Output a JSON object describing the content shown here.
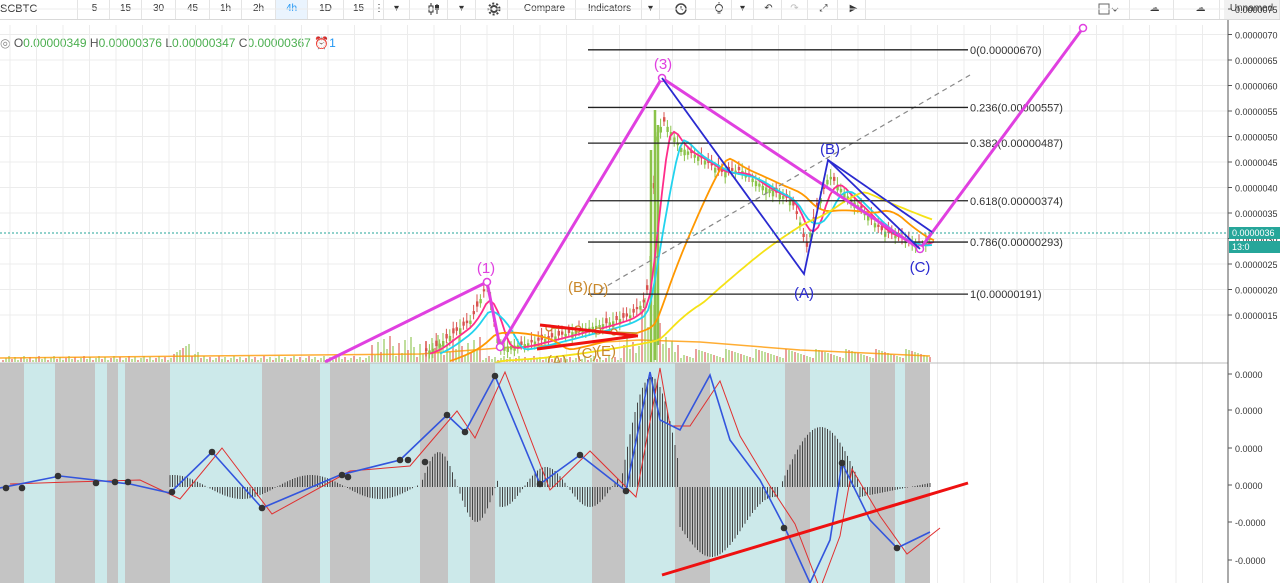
{
  "toolbar": {
    "symbol": "SCBTC",
    "intervals": [
      "5",
      "15",
      "30",
      "45",
      "1h",
      "2h",
      "4h",
      "1D",
      "15"
    ],
    "active_interval": "4h",
    "compare_label": "Compare",
    "indicators_label": "Indicators",
    "layout_name": "Unnamed"
  },
  "legend": {
    "open_key": "O",
    "open": "0.00000349",
    "high_key": "H",
    "high": "0.00000376",
    "low_key": "L",
    "low": "0.00000347",
    "close_key": "C",
    "close": "0.00000367",
    "alerts_count": "1"
  },
  "price_axis": {
    "labels": [
      "0.0000075",
      "0.0000070",
      "0.0000065",
      "0.0000060",
      "0.0000055",
      "0.0000050",
      "0.0000045",
      "0.0000040",
      "0.0000035",
      "0.0000030",
      "0.0000025",
      "0.0000020",
      "0.0000015"
    ],
    "current_price": "0.0000036",
    "current_tag": "13:0"
  },
  "osc_axis": {
    "labels": [
      "0.0000",
      "0.0000",
      "0.0000",
      "0.0000",
      "-0.0000",
      "-0.0000"
    ]
  },
  "fib_levels": [
    {
      "ratio": "0",
      "price": 6.7e-06,
      "label": "0(0.00000670)"
    },
    {
      "ratio": "0.236",
      "price": 5.57e-06,
      "label": "0.236(0.00000557)"
    },
    {
      "ratio": "0.382",
      "price": 4.87e-06,
      "label": "0.382(0.00000487)"
    },
    {
      "ratio": "0.618",
      "price": 3.74e-06,
      "label": "0.618(0.00000374)"
    },
    {
      "ratio": "0.786",
      "price": 2.93e-06,
      "label": "0.786(0.00000293)"
    },
    {
      "ratio": "1",
      "price": 1.91e-06,
      "label": "1(0.00000191)"
    }
  ],
  "wave_labels": {
    "w1": "(1)",
    "w3": "(3)",
    "small_a": "(A)",
    "small_b": "(B)",
    "small_c": "(C)",
    "small_d": "(D)",
    "small_e": "(E)",
    "big_a": "(A)",
    "big_b": "(B)",
    "big_c": "(C)"
  },
  "colors": {
    "impulse": "#e040e0",
    "correction": "#2a2ad0",
    "fib": "#222222",
    "trend": "#ee1111",
    "triangle": "#c9882a",
    "up_candle": "#8bc34a",
    "down_candle": "#d9534f",
    "ma_cyan": "#22d3ee",
    "ma_orange": "#ff9800",
    "ma_yellow": "#f5e216",
    "ma_pink": "#ff2d8a",
    "macd_line": "#3355dd",
    "signal_line": "#e03030",
    "osc_bg": "#cce9ea",
    "osc_band": "#c4c4c4",
    "price_line": "#26a69a"
  },
  "chart_data": {
    "type": "line",
    "title": "",
    "series": [
      {
        "name": "",
        "points": [
          {
            "label": "(1)",
            "price": 2.7e-06
          },
          {
            "label": "",
            "price": 1.6e-06
          },
          {
            "label": "(3)",
            "price": 6.7e-06
          },
          {
            "label": "(A)",
            "price": 2.9e-06
          },
          {
            "label": "(B)",
            "price": 5.05e-06
          },
          {
            "label": "(C)",
            "price": 3.35e-06
          }
        ]
      }
    ],
    "ylim": [
      1.5e-06,
      7.5e-06
    ],
    "grid": true,
    "xlabel": "",
    "ylabel": ""
  }
}
